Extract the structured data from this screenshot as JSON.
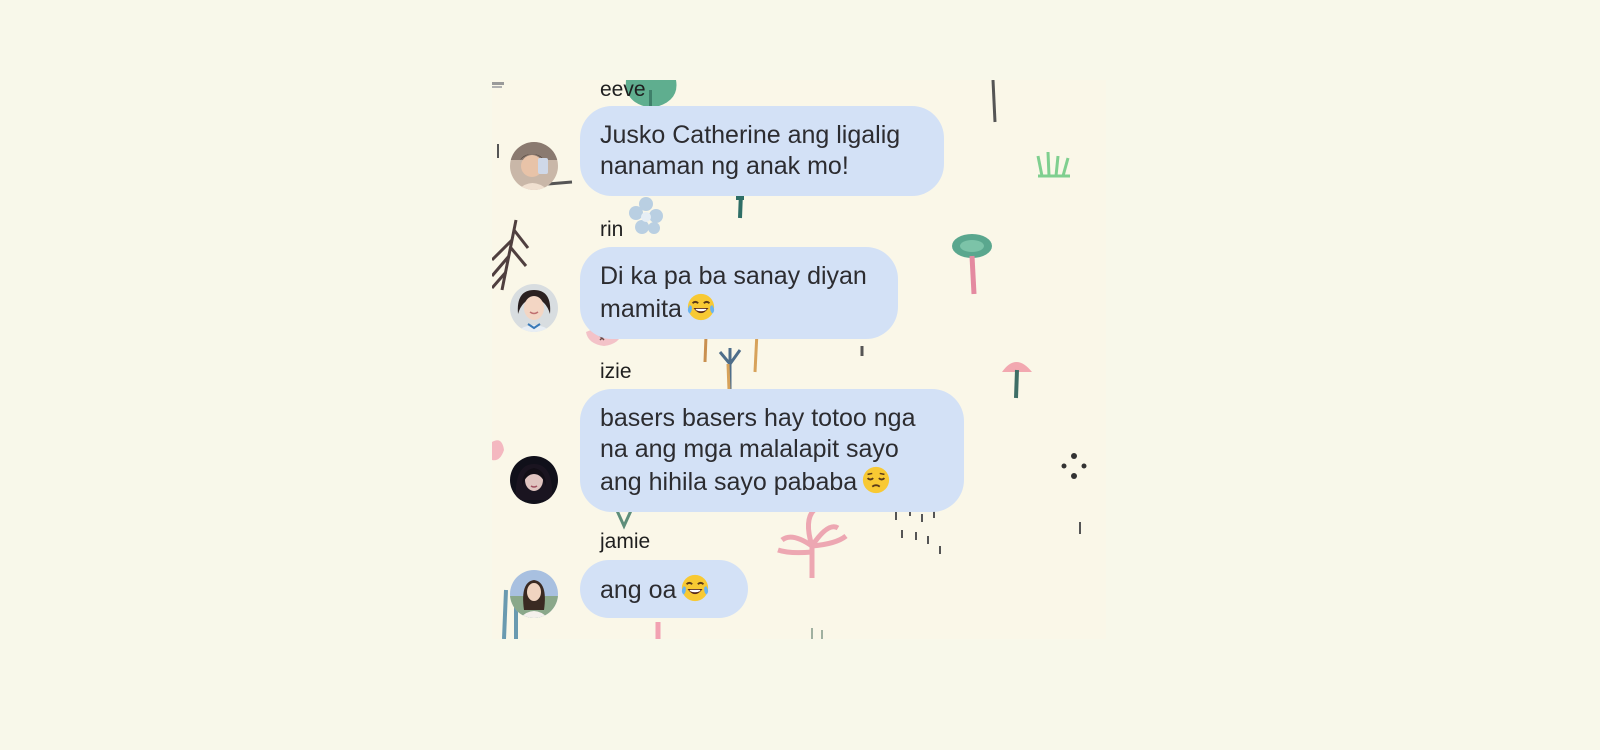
{
  "chat": {
    "messages": [
      {
        "sender": "eeve",
        "lines": [
          "Jusko Catherine ang ligalig",
          "nanaman ng anak mo!"
        ],
        "emoji": "",
        "avatar_icon": "eeve-avatar"
      },
      {
        "sender": "rin",
        "lines": [
          "Di ka pa ba sanay diyan",
          "mamita"
        ],
        "emoji": "face-with-tears-of-joy",
        "avatar_icon": "rin-avatar"
      },
      {
        "sender": "izie",
        "lines": [
          "basers basers hay totoo nga",
          "na ang mga malalapit sayo",
          "ang hihila sayo pababa"
        ],
        "emoji": "pensive-face",
        "avatar_icon": "izie-avatar"
      },
      {
        "sender": "jamie",
        "lines": [
          "ang oa"
        ],
        "emoji": "face-with-tears-of-joy",
        "avatar_icon": "jamie-avatar"
      }
    ]
  },
  "colors": {
    "page_background": "#f8f8ea",
    "chat_background": "#faf7e8",
    "bubble": "#d3e1f6",
    "text": "#2c2c30"
  }
}
